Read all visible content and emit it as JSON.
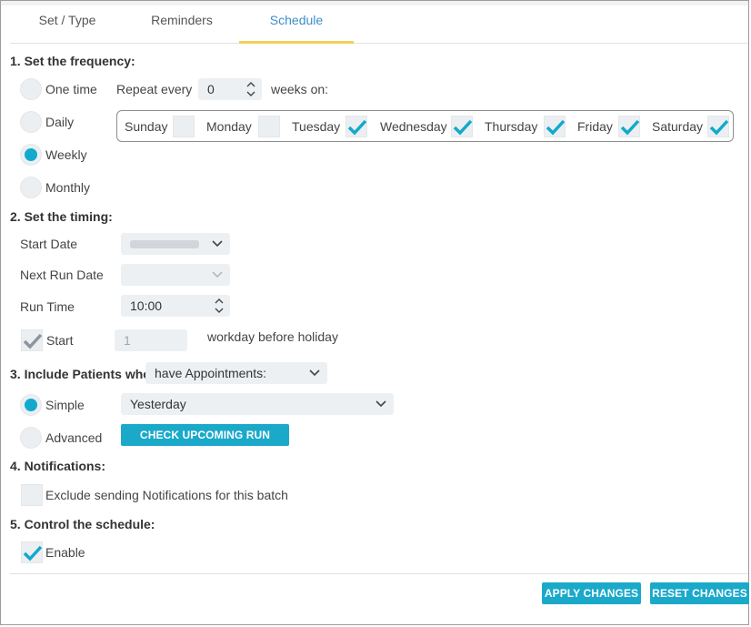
{
  "tabs": [
    {
      "label": "Set / Type",
      "active": false
    },
    {
      "label": "Reminders",
      "active": false
    },
    {
      "label": "Schedule",
      "active": true
    }
  ],
  "frequency": {
    "heading": "1. Set the frequency:",
    "options": [
      {
        "label": "One time",
        "selected": false
      },
      {
        "label": "Daily",
        "selected": false
      },
      {
        "label": "Weekly",
        "selected": true
      },
      {
        "label": "Monthly",
        "selected": false
      }
    ],
    "repeat_label": "Repeat every",
    "repeat_value": "0",
    "weeks_on_label": "weeks on:",
    "days": [
      {
        "label": "Sunday",
        "checked": false
      },
      {
        "label": "Monday",
        "checked": false
      },
      {
        "label": "Tuesday",
        "checked": true
      },
      {
        "label": "Wednesday",
        "checked": true
      },
      {
        "label": "Thursday",
        "checked": true
      },
      {
        "label": "Friday",
        "checked": true
      },
      {
        "label": "Saturday",
        "checked": true
      }
    ]
  },
  "timing": {
    "heading": "2. Set the timing:",
    "start_date_label": "Start Date",
    "next_run_label": "Next Run Date",
    "run_time_label": "Run Time",
    "run_time_value": "10:00",
    "start_label": "Start",
    "start_value": "1",
    "holiday_label": "workday before holiday"
  },
  "patients": {
    "heading": "3. Include Patients who",
    "filter_value": "have Appointments:",
    "simple_label": "Simple",
    "advanced_label": "Advanced",
    "simple_value": "Yesterday",
    "check_button": "CHECK UPCOMING RUN DATES"
  },
  "notifications": {
    "heading": "4. Notifications:",
    "exclude_label": "Exclude sending Notifications for this batch"
  },
  "control": {
    "heading": "5. Control the schedule:",
    "enable_label": "Enable"
  },
  "footer": {
    "apply": "APPLY CHANGES",
    "reset": "RESET CHANGES"
  },
  "colors": {
    "accent": "#1ba9ca",
    "tab_active_text": "#3a8fc9",
    "tab_underline": "#f0cf5a",
    "check_color": "#12aacc",
    "disabled_check": "#8c96a0"
  },
  "icons": {
    "check": "check-icon",
    "dropdown": "chevron-down-icon",
    "spinner": "spinner-arrows-icon"
  }
}
